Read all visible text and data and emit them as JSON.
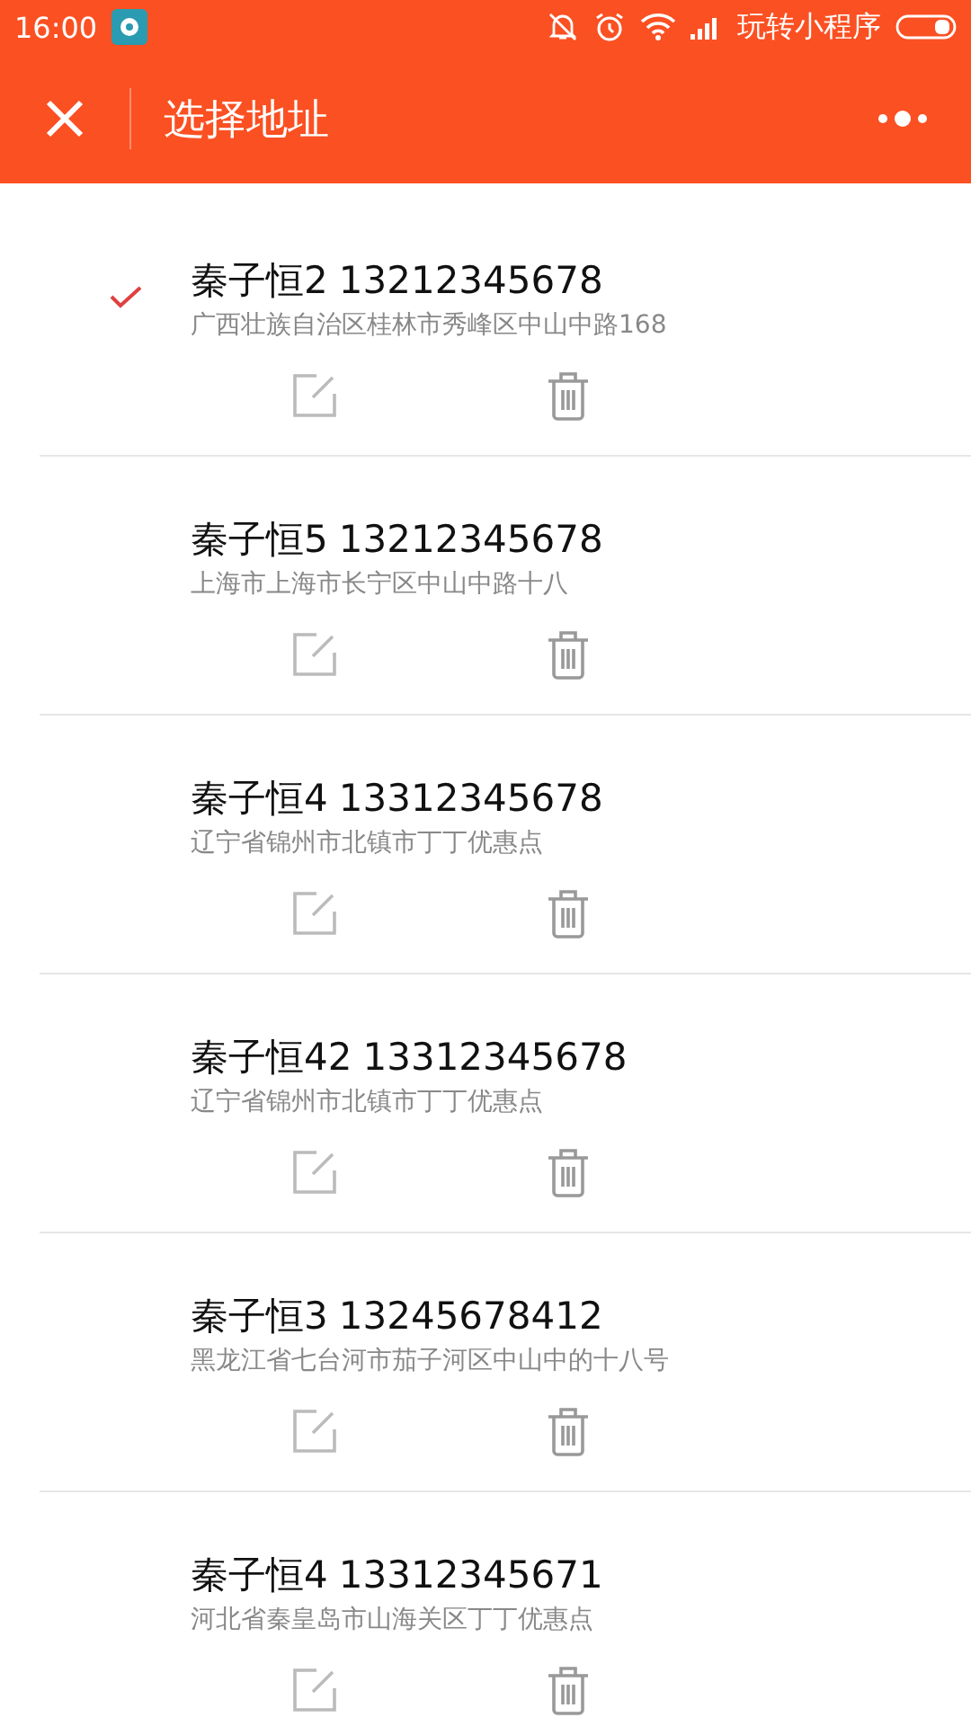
{
  "status_bar": {
    "time": "16:00",
    "carrier": "玩转小程序"
  },
  "nav": {
    "title": "选择地址"
  },
  "addresses": [
    {
      "name": "秦子恒2",
      "phone": "13212345678",
      "address": "广西壮族自治区桂林市秀峰区中山中路168",
      "selected": true
    },
    {
      "name": "秦子恒5",
      "phone": "13212345678",
      "address": "上海市上海市长宁区中山中路十八",
      "selected": false
    },
    {
      "name": "秦子恒4",
      "phone": "13312345678",
      "address": "辽宁省锦州市北镇市丁丁优惠点",
      "selected": false
    },
    {
      "name": "秦子恒42",
      "phone": "13312345678",
      "address": "辽宁省锦州市北镇市丁丁优惠点",
      "selected": false
    },
    {
      "name": "秦子恒3",
      "phone": "13245678412",
      "address": "黑龙江省七台河市茄子河区中山中的十八号",
      "selected": false
    },
    {
      "name": "秦子恒4",
      "phone": "13312345671",
      "address": "河北省秦皇岛市山海关区丁丁优惠点",
      "selected": false
    }
  ]
}
